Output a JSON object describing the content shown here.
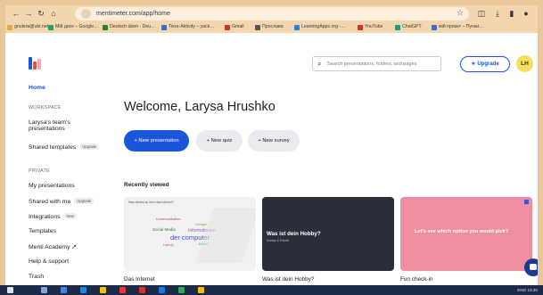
{
  "browser": {
    "url": "mentimeter.com/app/home",
    "bookmarks": [
      "gnulera@ukr.net",
      "Мій диск – Google…",
      "Deutsch üben - Deu…",
      "Tiere-Aktivity – yack…",
      "Gmail",
      "Прослава",
      "LearningApps.org -…",
      "YouTube",
      "ChatGPT",
      "мій проєкт – Пунки…"
    ]
  },
  "header": {
    "search_placeholder": "Search presentations, folders, and pages",
    "upgrade_label": "★ Upgrade",
    "avatar_initials": "LH"
  },
  "sidebar": {
    "home": "Home",
    "workspace_heading": "WORKSPACE",
    "team_line1": "Larysa's team's",
    "team_line2": "presentations",
    "shared_templates": "Shared templates",
    "shared_templates_tag": "Upgrade",
    "private_heading": "PRIVATE",
    "my_presentations": "My presentations",
    "shared_with_me": "Shared with me",
    "shared_with_me_tag": "Upgrade",
    "integrations": "Integrations",
    "integrations_tag": "New",
    "templates": "Templates",
    "menti_academy": "Menti Academy ↗",
    "help_support": "Help & support",
    "trash": "Trash"
  },
  "main": {
    "welcome": "Welcome, Larysa Hrushko",
    "new_presentation": "+ New presentation",
    "new_quiz": "+ New quiz",
    "new_survey": "+ New survey",
    "recently_viewed": "Recently viewed",
    "cards": [
      {
        "caption": "Das Internet",
        "title": "Was denkst du über das Internet?",
        "words": [
          "Kommunikation",
          "Google",
          "Social Media",
          "der computer",
          "Informationen",
          "Handy",
          "Daten"
        ]
      },
      {
        "caption": "Was ist dein Hobby?",
        "title": "Was ist dein Hobby?",
        "subtitle": "Hobbys & Freizeit"
      },
      {
        "caption": "Fun check-in",
        "title": "Let's see which option you would pick?"
      }
    ]
  },
  "taskbar": {
    "tray_text": "ENG 13:40"
  },
  "colors": {
    "accent": "#1a56db",
    "browser_chrome": "#f3d6ae",
    "card2_bg": "#2c2f3b",
    "card3_bg": "#ef8ea0"
  }
}
